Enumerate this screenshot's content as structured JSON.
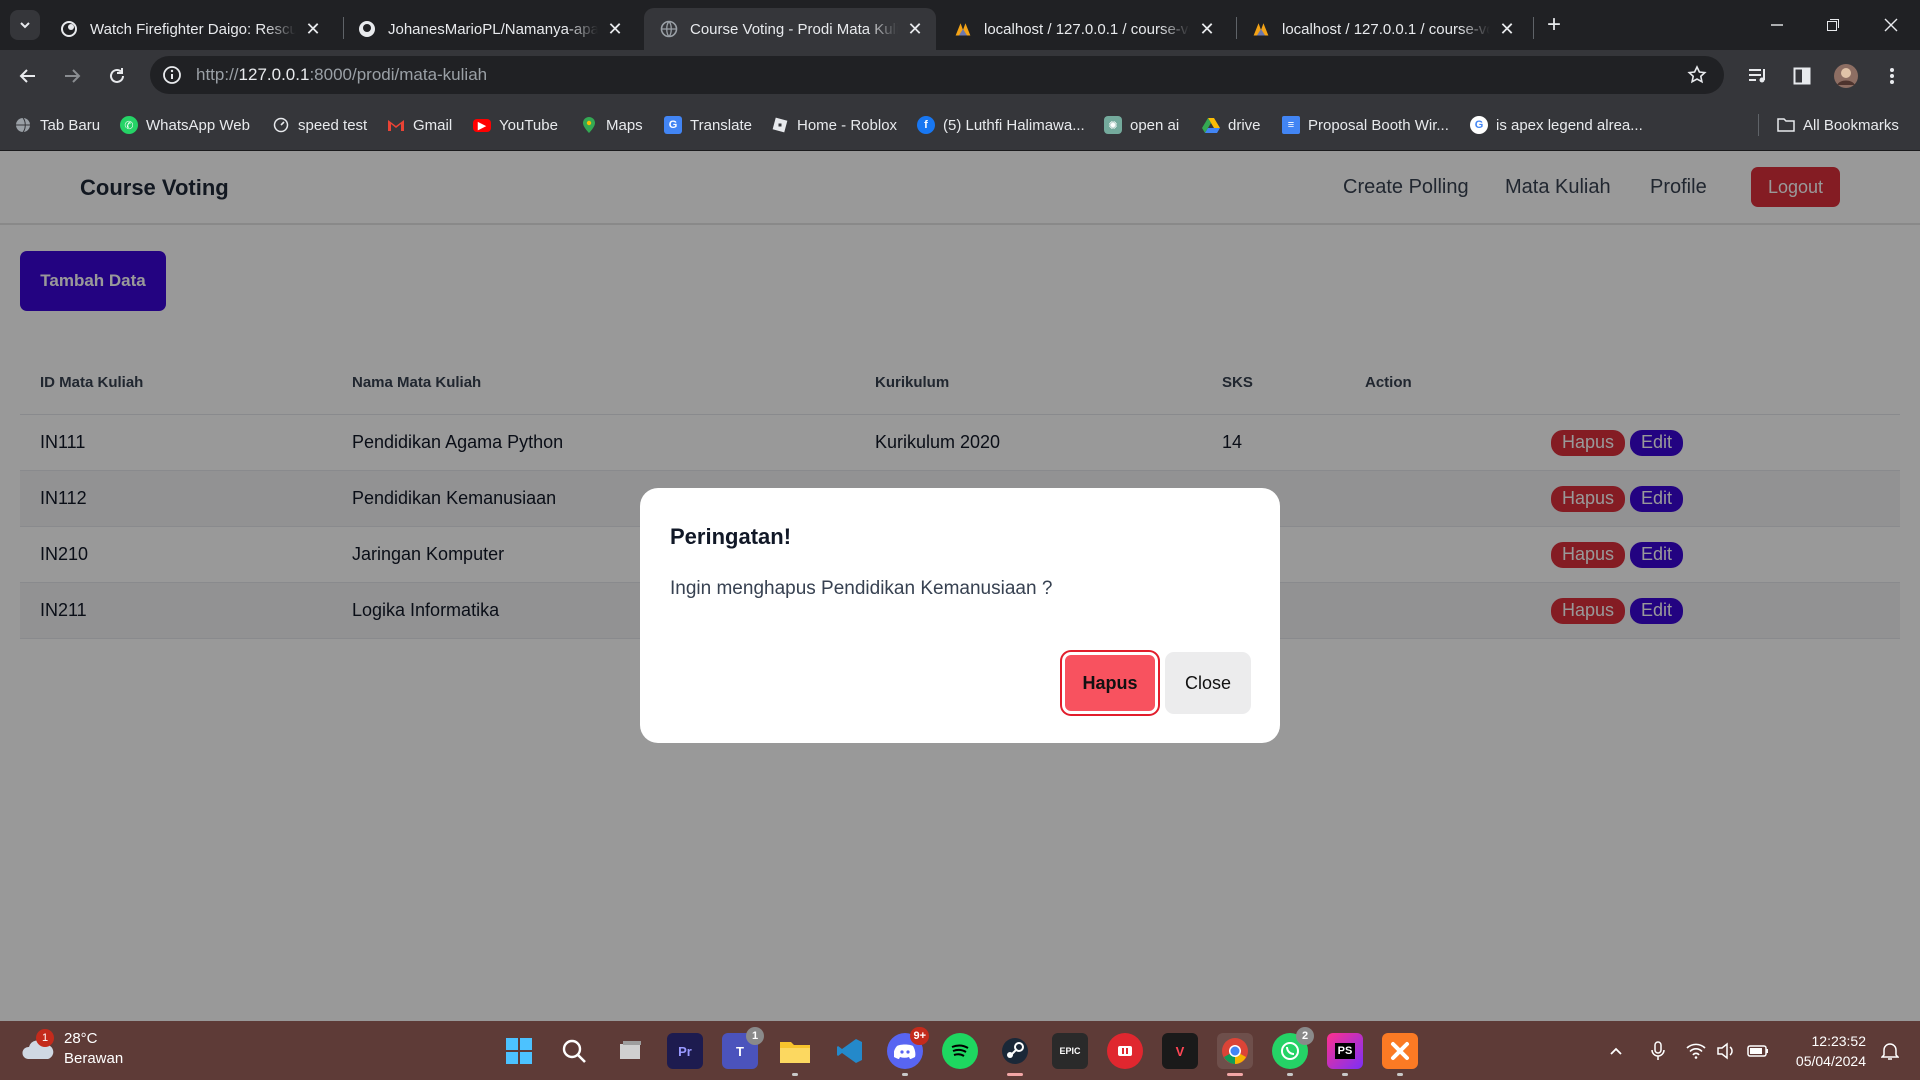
{
  "browser": {
    "tabs": [
      {
        "title": "Watch Firefighter Daigo: Rescue",
        "icon": "crunchyroll-icon"
      },
      {
        "title": "JohanesMarioPL/Namanya-apa",
        "icon": "github-icon"
      },
      {
        "title": "Course Voting - Prodi Mata Kuli",
        "icon": "globe-icon",
        "active": true
      },
      {
        "title": "localhost / 127.0.0.1 / course-vo",
        "icon": "phpmyadmin-icon"
      },
      {
        "title": "localhost / 127.0.0.1 / course-vo",
        "icon": "phpmyadmin-icon"
      }
    ],
    "url": {
      "prefix": "http://",
      "host": "127.0.0.1",
      "rest": ":8000/prodi/mata-kuliah"
    },
    "bookmarks": [
      {
        "label": "Tab Baru",
        "icon": "globe-icon"
      },
      {
        "label": "WhatsApp Web",
        "icon": "whatsapp-icon"
      },
      {
        "label": "speed test",
        "icon": "speedometer-icon"
      },
      {
        "label": "Gmail",
        "icon": "gmail-icon"
      },
      {
        "label": "YouTube",
        "icon": "youtube-icon"
      },
      {
        "label": "Maps",
        "icon": "maps-icon"
      },
      {
        "label": "Translate",
        "icon": "translate-icon"
      },
      {
        "label": "Home - Roblox",
        "icon": "roblox-icon"
      },
      {
        "label": "(5) Luthfi Halimawa...",
        "icon": "facebook-icon"
      },
      {
        "label": "open ai",
        "icon": "openai-icon"
      },
      {
        "label": "drive",
        "icon": "drive-icon"
      },
      {
        "label": "Proposal Booth Wir...",
        "icon": "docs-icon"
      },
      {
        "label": "is apex legend alrea...",
        "icon": "google-icon"
      }
    ],
    "all_bookmarks": "All Bookmarks"
  },
  "page": {
    "brand": "Course Voting",
    "nav": {
      "create_polling": "Create Polling",
      "mata_kuliah": "Mata Kuliah",
      "profile": "Profile",
      "logout": "Logout"
    },
    "add_button": "Tambah Data",
    "table": {
      "headers": [
        "ID Mata Kuliah",
        "Nama Mata Kuliah",
        "Kurikulum",
        "SKS",
        "Action"
      ],
      "rows": [
        {
          "id": "IN111",
          "nama": "Pendidikan Agama Python",
          "kurikulum": "Kurikulum 2020",
          "sks": "14"
        },
        {
          "id": "IN112",
          "nama": "Pendidikan Kemanusiaan",
          "kurikulum": "",
          "sks": ""
        },
        {
          "id": "IN210",
          "nama": "Jaringan Komputer",
          "kurikulum": "",
          "sks": ""
        },
        {
          "id": "IN211",
          "nama": "Logika Informatika",
          "kurikulum": "",
          "sks": ""
        }
      ],
      "hapus_label": "Hapus",
      "edit_label": "Edit"
    },
    "modal": {
      "title": "Peringatan!",
      "message": "Ingin menghapus Pendidikan Kemanusiaan ?",
      "confirm_label": "Hapus",
      "close_label": "Close"
    }
  },
  "taskbar": {
    "weather": {
      "temp": "28°C",
      "desc": "Berawan",
      "badge": "1"
    },
    "apps": [
      {
        "name": "windows-start-icon"
      },
      {
        "name": "search-icon"
      },
      {
        "name": "task-view-icon"
      },
      {
        "name": "premiere-pro-icon",
        "label": "Pr"
      },
      {
        "name": "teams-icon",
        "label": "T",
        "badge": "1"
      },
      {
        "name": "file-explorer-icon"
      },
      {
        "name": "vscode-icon"
      },
      {
        "name": "discord-icon",
        "badge": "9+"
      },
      {
        "name": "spotify-icon"
      },
      {
        "name": "steam-icon"
      },
      {
        "name": "epic-games-icon",
        "label": "EPIC"
      },
      {
        "name": "game-app-icon"
      },
      {
        "name": "valorant-icon",
        "label": "V"
      },
      {
        "name": "chrome-icon"
      },
      {
        "name": "whatsapp-icon",
        "badge": "2"
      },
      {
        "name": "phpstorm-icon",
        "label": "PS"
      },
      {
        "name": "xampp-icon"
      }
    ],
    "clock": {
      "time": "12:23:52",
      "date": "05/04/2024"
    }
  },
  "colors": {
    "primary": "#3b06d8",
    "danger": "#dc2f3b",
    "modal_confirm": "#f8525f",
    "taskbar": "#5e3b37"
  }
}
